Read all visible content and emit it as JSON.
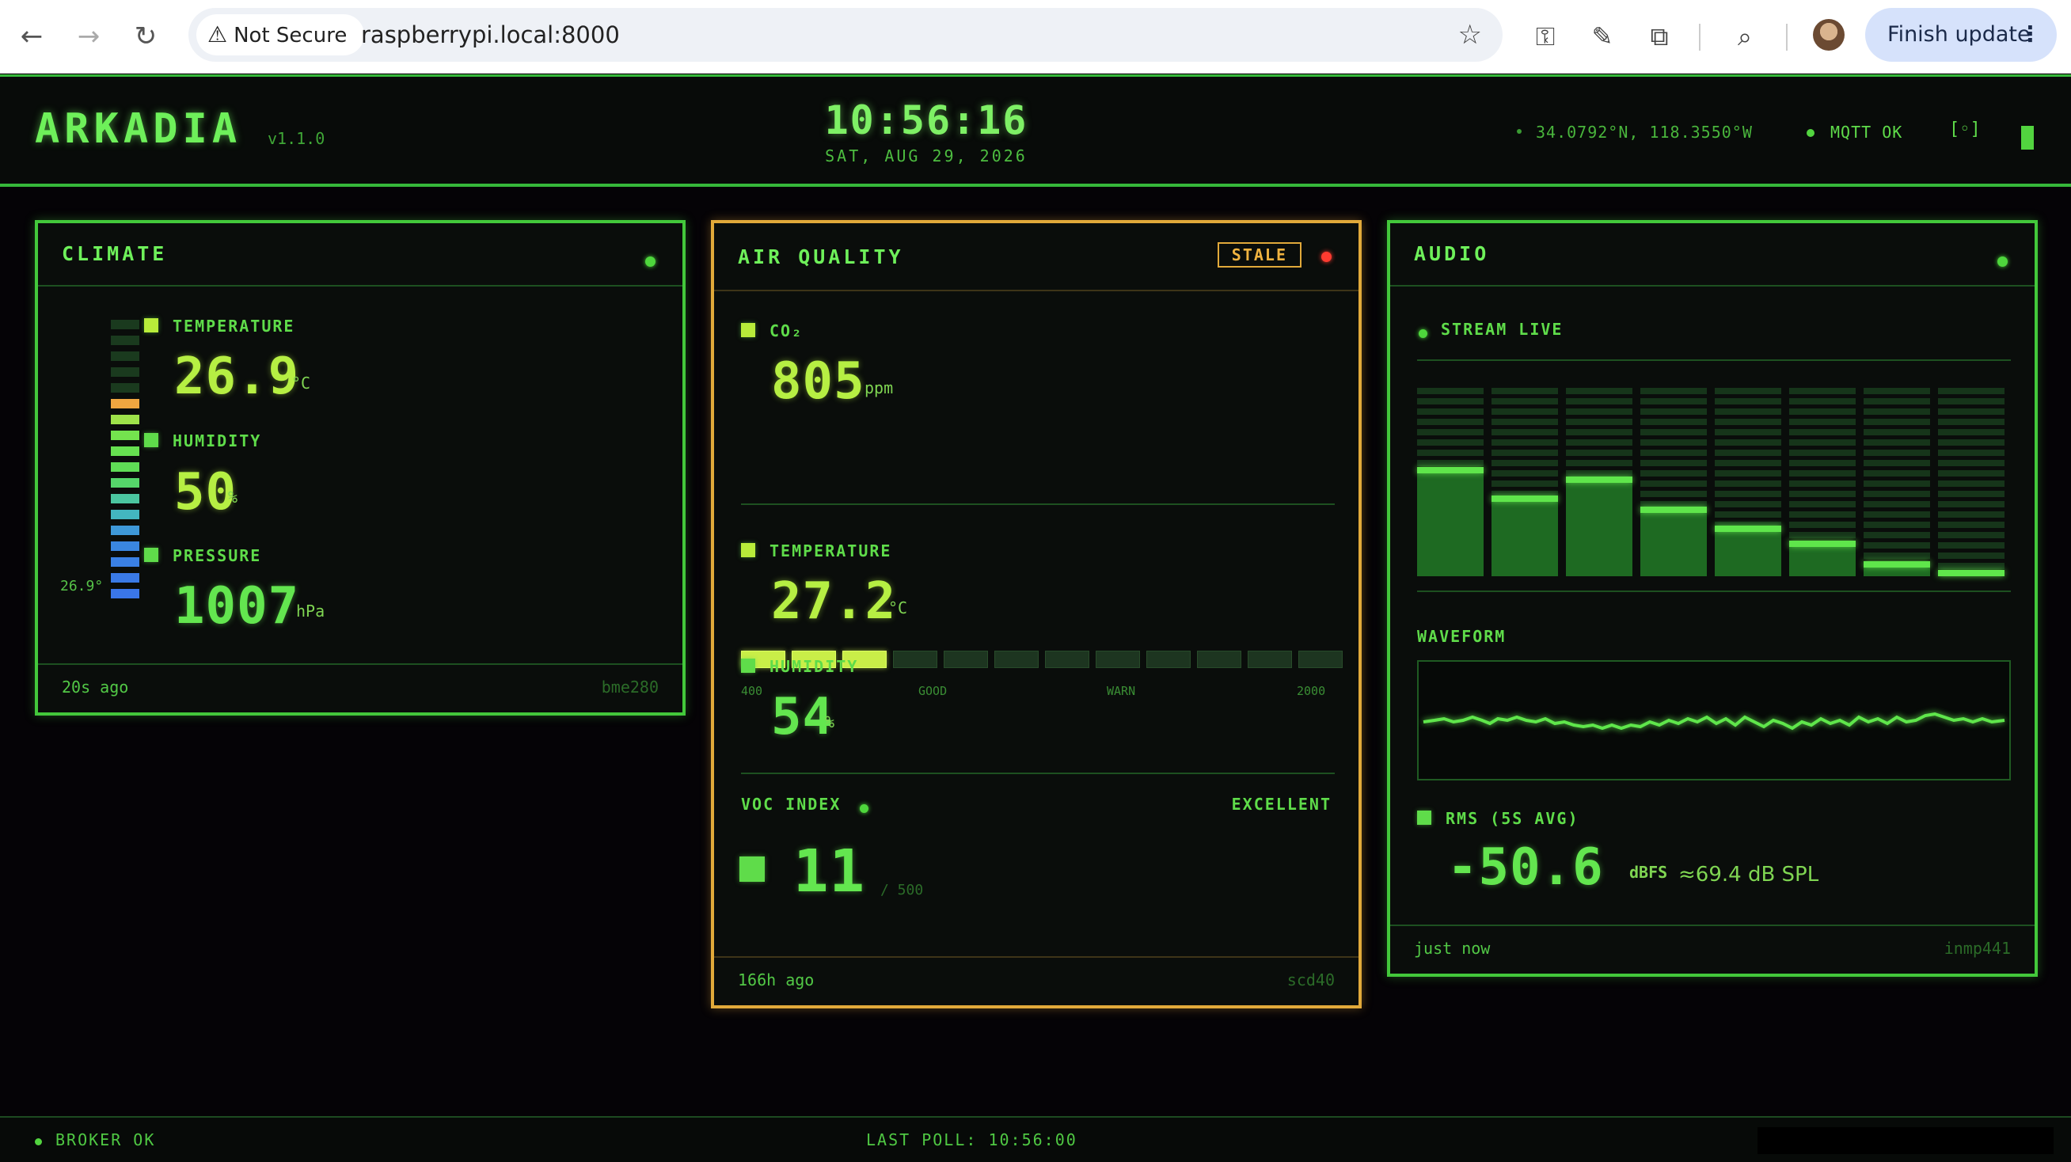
{
  "browser": {
    "security_label": "Not Secure",
    "url": "raspberrypi.local:8000",
    "finish_update_label": "Finish update",
    "icons": [
      "back-arrow-icon",
      "forward-arrow-icon",
      "reload-icon",
      "warning-icon",
      "star-icon",
      "password-manager-icon",
      "eyedropper-icon",
      "extensions-icon",
      "tab-search-icon",
      "profile-avatar",
      "more-vert-icon"
    ]
  },
  "header": {
    "app_name": "ARKADIA",
    "version": "v1.1.0",
    "time": "10:56:16",
    "date": "SAT, AUG 29, 2026",
    "coordinates": "34.0792°N, 118.3550°W",
    "mqtt_status": "MQTT OK",
    "expand_icon_label": "[◦]"
  },
  "climate": {
    "title": "CLIMATE",
    "status": "ok",
    "gauge_value": "26.9°",
    "temperature": {
      "label": "TEMPERATURE",
      "value": "26.9",
      "unit": "°C"
    },
    "humidity": {
      "label": "HUMIDITY",
      "value": "50",
      "unit": "%"
    },
    "pressure": {
      "label": "PRESSURE",
      "value": "1007",
      "unit": "hPa"
    },
    "updated": "20s ago",
    "sensor": "bme280"
  },
  "air_quality": {
    "title": "AIR QUALITY",
    "stale_label": "STALE",
    "co2": {
      "label": "CO₂",
      "value": "805",
      "unit": "ppm",
      "segments_total": 12,
      "segments_lit": 3
    },
    "scale": {
      "min": "400",
      "good": "GOOD",
      "warn": "WARN",
      "max": "2000"
    },
    "temperature": {
      "label": "TEMPERATURE",
      "value": "27.2",
      "unit": "°C"
    },
    "humidity": {
      "label": "HUMIDITY",
      "value": "54",
      "unit": "%"
    },
    "voc": {
      "label": "VOC INDEX",
      "rating": "EXCELLENT",
      "value": "11",
      "max": "/ 500"
    },
    "updated": "166h ago",
    "sensor": "scd40"
  },
  "audio": {
    "title": "AUDIO",
    "stream_label": "STREAM LIVE",
    "spectrum_levels": [
      0.58,
      0.43,
      0.53,
      0.37,
      0.27,
      0.19,
      0.08,
      0.01
    ],
    "waveform_label": "WAVEFORM",
    "rms": {
      "label": "RMS (5S AVG)",
      "value": "-50.6",
      "unit": "dBFS",
      "spl": "≈69.4 dB SPL"
    },
    "updated": "just now",
    "sensor": "inmp441"
  },
  "statusbar": {
    "broker": "BROKER OK",
    "last_poll": "LAST POLL: 10:56:00"
  },
  "colors": {
    "accent_green": "#5fdc4a",
    "stale_amber": "#e1a93a",
    "alert_red": "#ff3b30",
    "value_yellow": "#b6ef43"
  }
}
